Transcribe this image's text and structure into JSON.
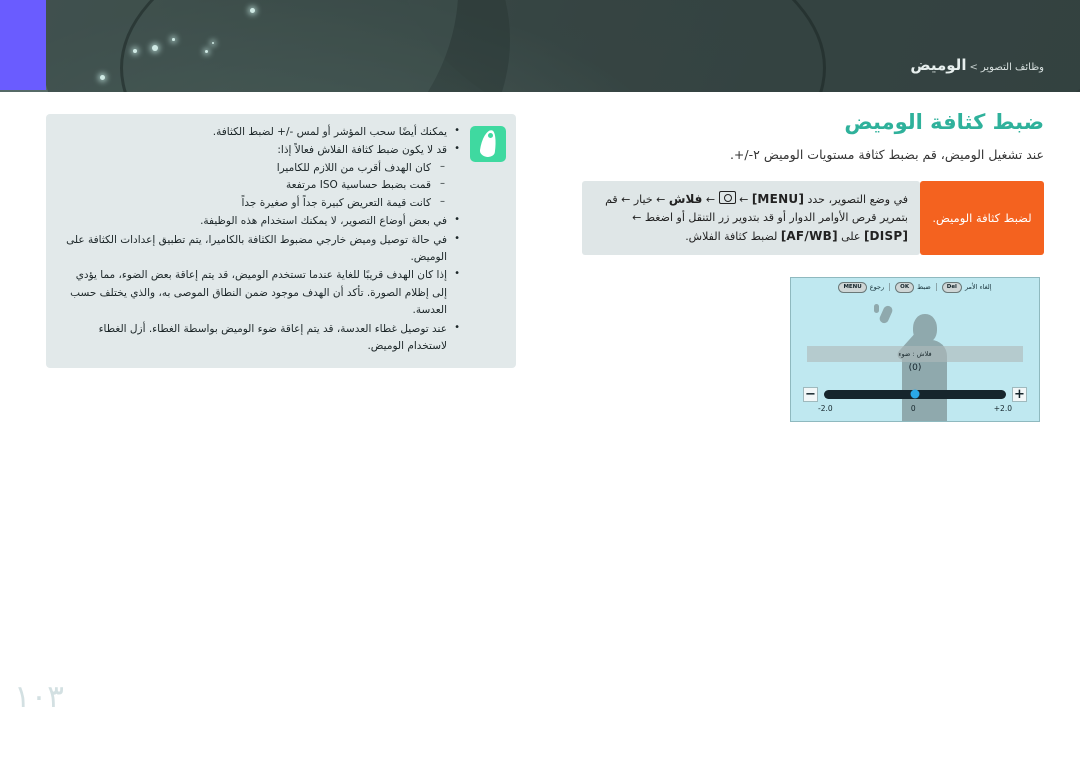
{
  "header": {
    "breadcrumb": {
      "parent": "وظائف التصوير",
      "separator": ">",
      "current": "الوميض"
    }
  },
  "main": {
    "section_title": "ضبط كثافة الوميض",
    "section_subtitle": "عند تشغيل الوميض، قم بضبط كثافة مستويات الوميض ‎+/-‎٢.",
    "instruction": {
      "line1_prefix": "في وضع التصوير، حدد",
      "menu_key": "[MENU]",
      "arrow": "←",
      "camera_icon": "camera-icon",
      "flash_label": "فلاش",
      "option_label": "خيار",
      "line2": "قم بتمرير قرص الأوامر الدوار أو قد بتدوير زر التنقل أو اضغط",
      "disp_key": "[DISP]",
      "line3_prefix": "على",
      "afwb_key": "[AF/WB]",
      "line3_suffix": "لضبط كثافة الفلاش."
    },
    "orange_tag": "لضبط كثافة الوميض."
  },
  "camera_screen": {
    "statusbar": {
      "back_key": "MENU",
      "back_label": "رجوع",
      "ok_key": "OK",
      "ok_label": "ضبط",
      "cancel_key": "Del",
      "cancel_label": "إلغاء الأمر"
    },
    "mode_label": "فلاش : ضوء",
    "value": "(0)",
    "minus_button": "−",
    "plus_button": "+",
    "tick_min": "-2.0",
    "tick_mid": "0",
    "tick_max": "+2.0",
    "knob_position_percent": 50
  },
  "note_box": {
    "icon": "note-pen-icon",
    "items": [
      {
        "text": "يمكنك أيضًا سحب المؤشر أو لمس ‎+/-‎ لضبط الكثافة.",
        "sub": []
      },
      {
        "text": "قد لا يكون ضبط كثافة الفلاش فعالاً إذا:",
        "sub": [
          "كان الهدف أقرب من اللازم للكاميرا",
          "قمت بضبط حساسية ISO مرتفعة",
          "كانت قيمة التعريض كبيرة جداً أو صغيرة جداً"
        ]
      },
      {
        "text": "في بعض أوضاع التصوير، لا يمكنك استخدام هذه الوظيفة.",
        "sub": []
      },
      {
        "text": "في حالة توصيل وميض خارجي مضبوط الكثافة بالكاميرا، يتم تطبيق إعدادات الكثافة على الوميض.",
        "sub": []
      },
      {
        "text": "إذا كان الهدف قريبًا للغاية عندما تستخدم الوميض، قد يتم إعاقة بعض الضوء، مما يؤدي إلى إظلام الصورة. تأكد أن الهدف موجود ضمن النطاق الموصى به، والذي يختلف حسب العدسة.",
        "sub": []
      },
      {
        "text": "عند توصيل غطاء العدسة، قد يتم إعاقة ضوء الوميض بواسطة الغطاء. أزل الغطاء لاستخدام الوميض.",
        "sub": []
      }
    ]
  },
  "footer": {
    "page_number": "١٠٣"
  },
  "colors": {
    "accent_teal": "#2fb19b",
    "orange": "#f4621f",
    "note_green": "#3fd9a0",
    "header_dark": "#3b4a48",
    "purple_bar": "#6a5cff",
    "screen_blue": "#bfe8f0",
    "knob_blue": "#2aa8e8"
  }
}
